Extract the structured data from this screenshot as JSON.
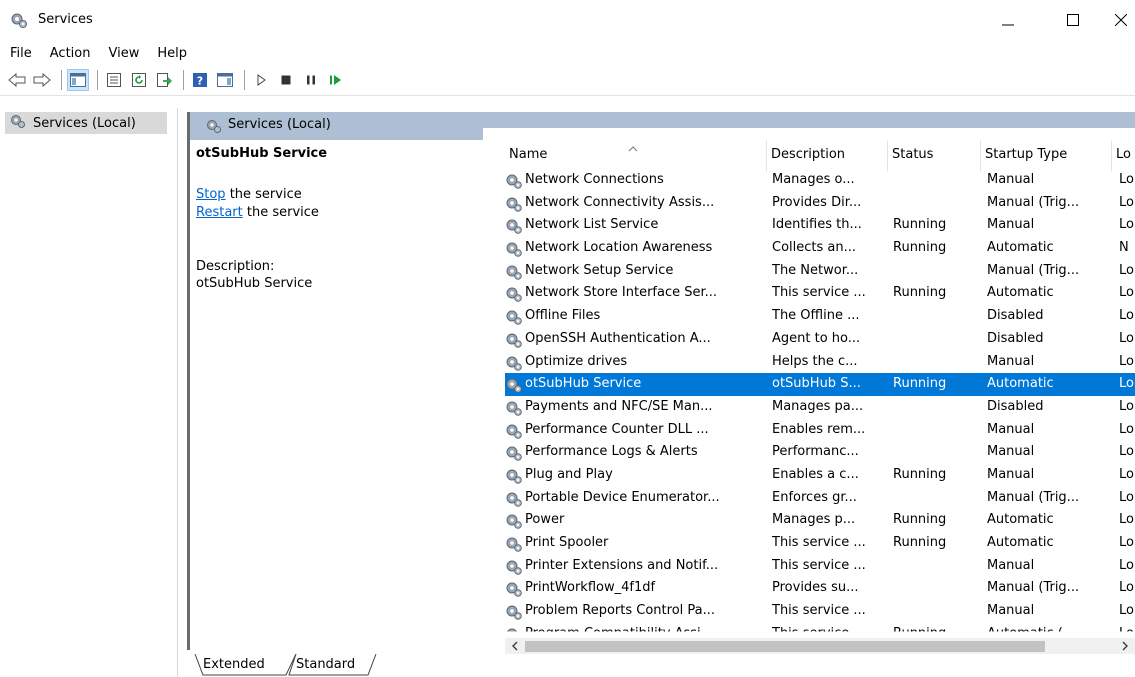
{
  "window": {
    "title": "Services"
  },
  "menu": [
    "File",
    "Action",
    "View",
    "Help"
  ],
  "tree": {
    "root_label": "Services (Local)"
  },
  "panel": {
    "header_label": "Services (Local)",
    "selected_service_title": "otSubHub Service",
    "actions": {
      "stop_link": "Stop",
      "stop_rest": " the service",
      "restart_link": "Restart",
      "restart_rest": " the service"
    },
    "description_label": "Description:",
    "description_text": "otSubHub Service"
  },
  "table": {
    "columns": {
      "name": "Name",
      "description": "Description",
      "status": "Status",
      "startup": "Startup Type",
      "logon": "Lo"
    },
    "rows": [
      {
        "name": "Network Connections",
        "description": "Manages o...",
        "status": "",
        "startup": "Manual",
        "logon": "Lo"
      },
      {
        "name": "Network Connectivity Assis...",
        "description": "Provides Dir...",
        "status": "",
        "startup": "Manual (Trig...",
        "logon": "Lo"
      },
      {
        "name": "Network List Service",
        "description": "Identifies th...",
        "status": "Running",
        "startup": "Manual",
        "logon": "Lo"
      },
      {
        "name": "Network Location Awareness",
        "description": "Collects an...",
        "status": "Running",
        "startup": "Automatic",
        "logon": "N"
      },
      {
        "name": "Network Setup Service",
        "description": "The Networ...",
        "status": "",
        "startup": "Manual (Trig...",
        "logon": "Lo"
      },
      {
        "name": "Network Store Interface Ser...",
        "description": "This service ...",
        "status": "Running",
        "startup": "Automatic",
        "logon": "Lo"
      },
      {
        "name": "Offline Files",
        "description": "The Offline ...",
        "status": "",
        "startup": "Disabled",
        "logon": "Lo"
      },
      {
        "name": "OpenSSH Authentication A...",
        "description": "Agent to ho...",
        "status": "",
        "startup": "Disabled",
        "logon": "Lo"
      },
      {
        "name": "Optimize drives",
        "description": "Helps the c...",
        "status": "",
        "startup": "Manual",
        "logon": "Lo"
      },
      {
        "name": "otSubHub Service",
        "description": "otSubHub S...",
        "status": "Running",
        "startup": "Automatic",
        "logon": "Lo",
        "selected": true
      },
      {
        "name": "Payments and NFC/SE Man...",
        "description": "Manages pa...",
        "status": "",
        "startup": "Disabled",
        "logon": "Lo"
      },
      {
        "name": "Performance Counter DLL ...",
        "description": "Enables rem...",
        "status": "",
        "startup": "Manual",
        "logon": "Lo"
      },
      {
        "name": "Performance Logs & Alerts",
        "description": "Performanc...",
        "status": "",
        "startup": "Manual",
        "logon": "Lo"
      },
      {
        "name": "Plug and Play",
        "description": "Enables a c...",
        "status": "Running",
        "startup": "Manual",
        "logon": "Lo"
      },
      {
        "name": "Portable Device Enumerator...",
        "description": "Enforces gr...",
        "status": "",
        "startup": "Manual (Trig...",
        "logon": "Lo"
      },
      {
        "name": "Power",
        "description": "Manages p...",
        "status": "Running",
        "startup": "Automatic",
        "logon": "Lo"
      },
      {
        "name": "Print Spooler",
        "description": "This service ...",
        "status": "Running",
        "startup": "Automatic",
        "logon": "Lo"
      },
      {
        "name": "Printer Extensions and Notif...",
        "description": "This service ...",
        "status": "",
        "startup": "Manual",
        "logon": "Lo"
      },
      {
        "name": "PrintWorkflow_4f1df",
        "description": "Provides su...",
        "status": "",
        "startup": "Manual (Trig...",
        "logon": "Lo"
      },
      {
        "name": "Problem Reports Control Pa...",
        "description": "This service ...",
        "status": "",
        "startup": "Manual",
        "logon": "Lo"
      },
      {
        "name": "Program Compatibility Assi...",
        "description": "This service ...",
        "status": "Running",
        "startup": "Automatic (...",
        "logon": "Lo",
        "partial": true
      }
    ]
  },
  "tabs": {
    "extended": "Extended",
    "standard": "Standard"
  },
  "colors": {
    "selection": "#0078d7",
    "panel_header": "#aebfd3",
    "link": "#0066cc"
  }
}
